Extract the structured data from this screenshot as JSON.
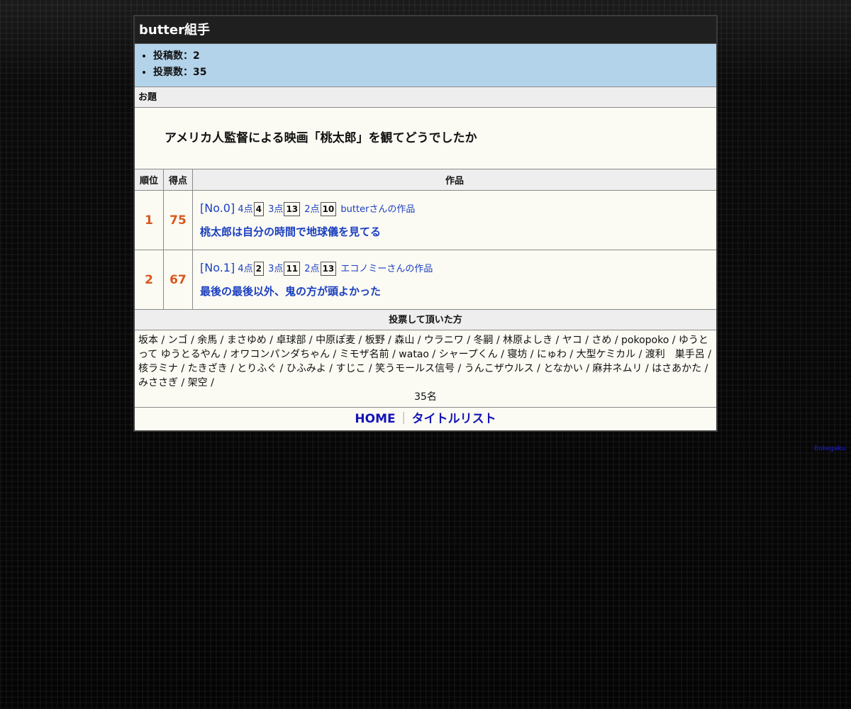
{
  "page": {
    "title": "butter組手",
    "stats": {
      "posts": "投稿数：2",
      "votes": "投票数：35"
    },
    "topic_heading": "お題",
    "topic": "アメリカ人監督による映画「桃太郎」を観てどうでしたか",
    "columns": {
      "rank": "順位",
      "score": "得点",
      "work": "作品"
    },
    "entries": [
      {
        "rank": "1",
        "score": "75",
        "no": "[No.0]",
        "p4_label": "4点",
        "p4": "4",
        "p3_label": "3点",
        "p3": "13",
        "p2_label": "2点",
        "p2": "10",
        "author": "butterさんの作品",
        "title": "桃太郎は自分の時間で地球儀を見てる"
      },
      {
        "rank": "2",
        "score": "67",
        "no": "[No.1]",
        "p4_label": "4点",
        "p4": "2",
        "p3_label": "3点",
        "p3": "11",
        "p2_label": "2点",
        "p2": "13",
        "author": "エコノミーさんの作品",
        "title": "最後の最後以外、鬼の方が頭よかった"
      }
    ],
    "voters_heading": "投票して頂いた方",
    "voters": "坂本 / ンゴ / 余馬 / まさゆめ / 卓球部 / 中原ぽ麦 / 板野 / 森山 / ウラニワ / 冬嗣 / 林原よしき / ヤコ / さめ / pokopoko / ゆうとって ゆうとるやん / オワコンパンダちゃん / ミモザ名前 / watao / シャープくん / 寝坊 / にゅわ / 大型ケミカル / 渡利　巣手呂 / 核ラミナ / たきざき / とりふぐ / ひふみよ / すじこ / 笑うモールス信号 / うんこザウルス / となかい / 麻井ネムリ / はさあかた / みささぎ / 架空 /",
    "voter_count": "35名",
    "footer": {
      "home": "HOME",
      "separator": "｜",
      "title_list": "タイトルリスト"
    },
    "credit": "Bokegaku"
  },
  "colors": {
    "header_bg": "#1f1f1f",
    "stats_bg": "#b3d3ea",
    "panel_bg": "#fbfaf3",
    "rank_score": "#d8581e",
    "link": "#1b3fc0",
    "footer_link": "#1414b8"
  }
}
